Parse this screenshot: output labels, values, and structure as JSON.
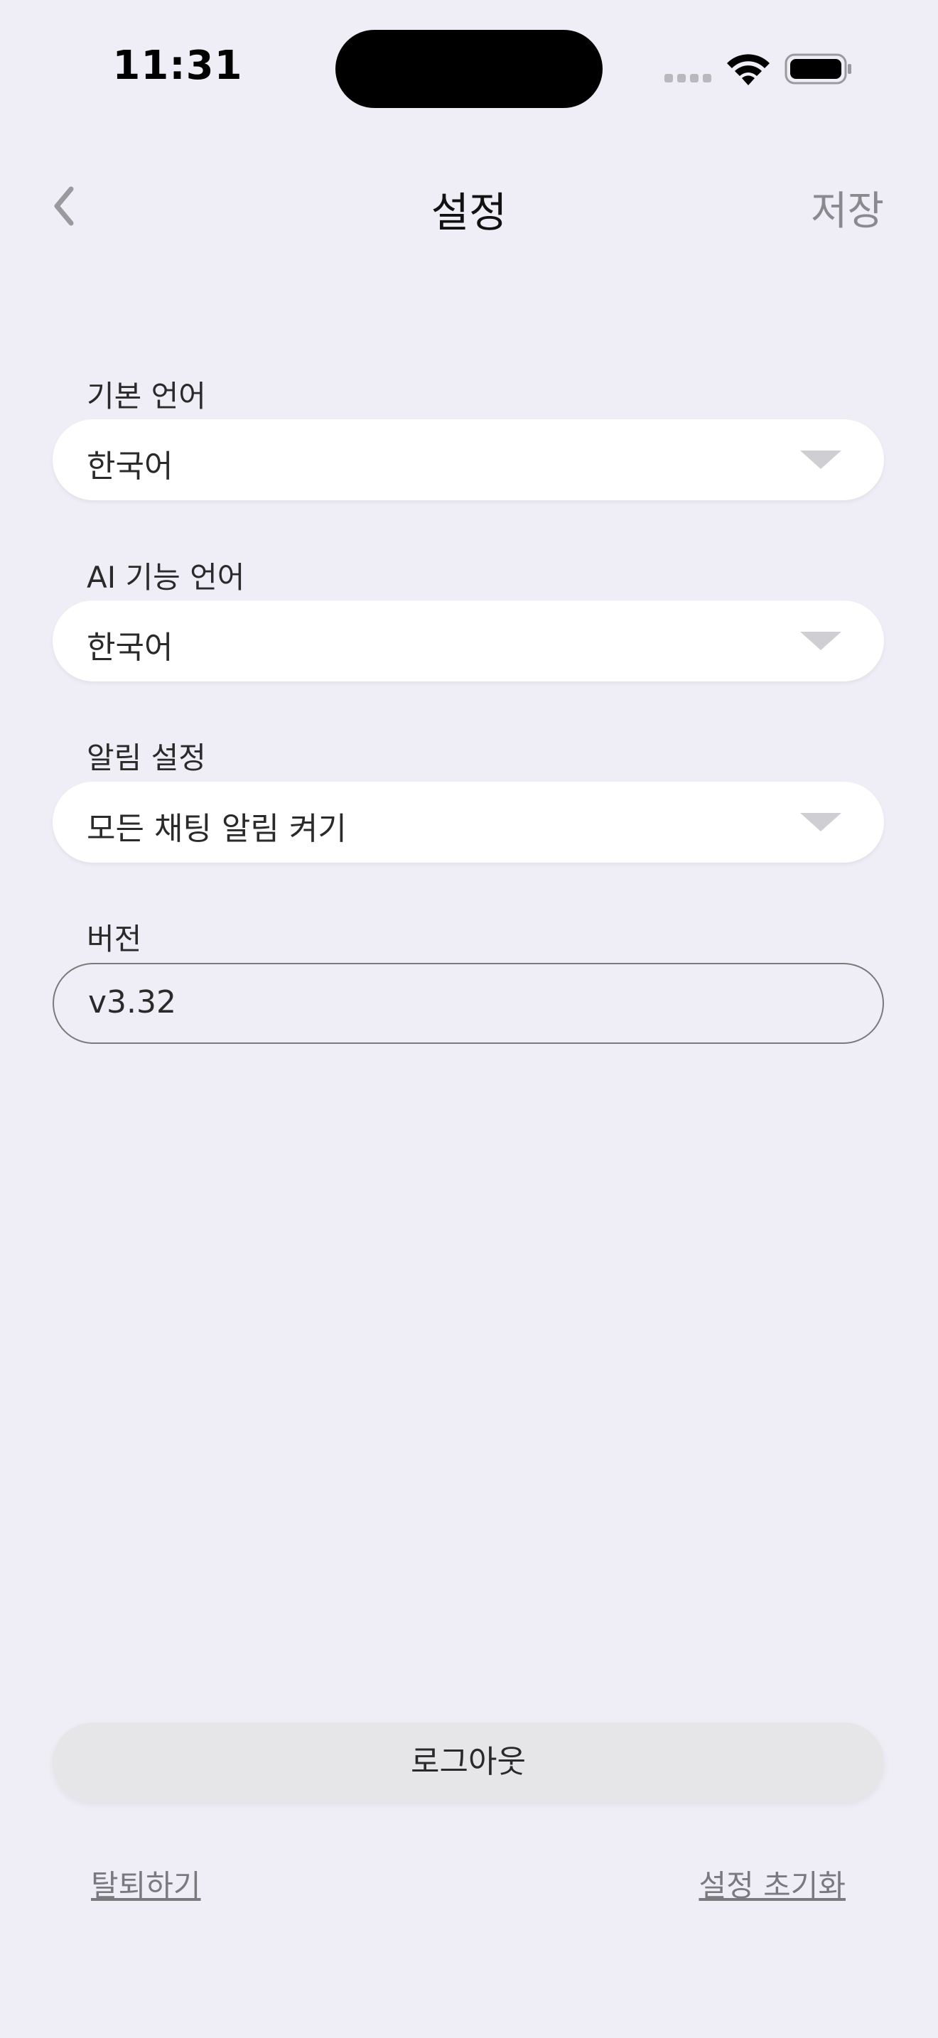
{
  "status_bar": {
    "time": "11:31"
  },
  "header": {
    "title": "설정",
    "save_label": "저장",
    "back_icon": "chevron-left-icon"
  },
  "settings": {
    "default_language": {
      "label": "기본 언어",
      "value": "한국어"
    },
    "ai_language": {
      "label": "AI 기능 언어",
      "value": "한국어"
    },
    "notifications": {
      "label": "알림 설정",
      "value": "모든 채팅 알림 켜기"
    },
    "version": {
      "label": "버전",
      "value": "v3.32"
    }
  },
  "footer": {
    "logout_label": "로그아웃",
    "withdraw_label": "탈퇴하기",
    "reset_label": "설정 초기화"
  },
  "colors": {
    "background": "#efeef6",
    "field_bg": "#ffffff",
    "logout_bg": "#e6e6e8",
    "muted_text": "#8a8a8e"
  }
}
